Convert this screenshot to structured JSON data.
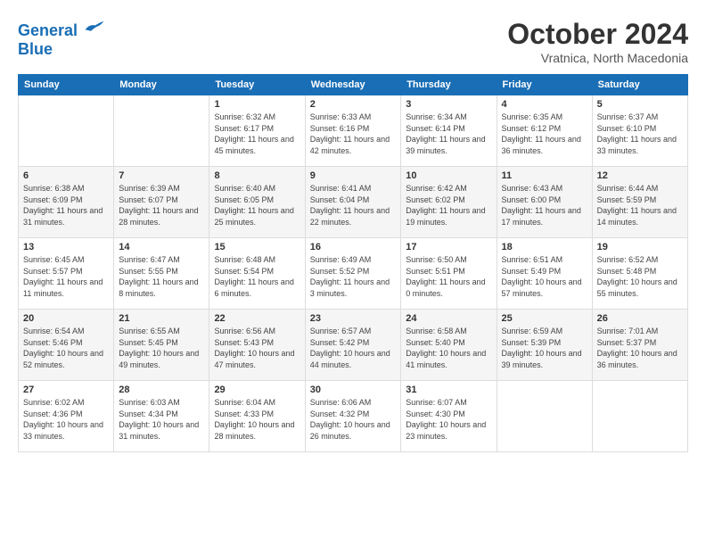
{
  "header": {
    "logo_line1": "General",
    "logo_line2": "Blue",
    "month_title": "October 2024",
    "location": "Vratnica, North Macedonia"
  },
  "weekdays": [
    "Sunday",
    "Monday",
    "Tuesday",
    "Wednesday",
    "Thursday",
    "Friday",
    "Saturday"
  ],
  "weeks": [
    [
      {
        "day": "",
        "sunrise": "",
        "sunset": "",
        "daylight": ""
      },
      {
        "day": "",
        "sunrise": "",
        "sunset": "",
        "daylight": ""
      },
      {
        "day": "1",
        "sunrise": "Sunrise: 6:32 AM",
        "sunset": "Sunset: 6:17 PM",
        "daylight": "Daylight: 11 hours and 45 minutes."
      },
      {
        "day": "2",
        "sunrise": "Sunrise: 6:33 AM",
        "sunset": "Sunset: 6:16 PM",
        "daylight": "Daylight: 11 hours and 42 minutes."
      },
      {
        "day": "3",
        "sunrise": "Sunrise: 6:34 AM",
        "sunset": "Sunset: 6:14 PM",
        "daylight": "Daylight: 11 hours and 39 minutes."
      },
      {
        "day": "4",
        "sunrise": "Sunrise: 6:35 AM",
        "sunset": "Sunset: 6:12 PM",
        "daylight": "Daylight: 11 hours and 36 minutes."
      },
      {
        "day": "5",
        "sunrise": "Sunrise: 6:37 AM",
        "sunset": "Sunset: 6:10 PM",
        "daylight": "Daylight: 11 hours and 33 minutes."
      }
    ],
    [
      {
        "day": "6",
        "sunrise": "Sunrise: 6:38 AM",
        "sunset": "Sunset: 6:09 PM",
        "daylight": "Daylight: 11 hours and 31 minutes."
      },
      {
        "day": "7",
        "sunrise": "Sunrise: 6:39 AM",
        "sunset": "Sunset: 6:07 PM",
        "daylight": "Daylight: 11 hours and 28 minutes."
      },
      {
        "day": "8",
        "sunrise": "Sunrise: 6:40 AM",
        "sunset": "Sunset: 6:05 PM",
        "daylight": "Daylight: 11 hours and 25 minutes."
      },
      {
        "day": "9",
        "sunrise": "Sunrise: 6:41 AM",
        "sunset": "Sunset: 6:04 PM",
        "daylight": "Daylight: 11 hours and 22 minutes."
      },
      {
        "day": "10",
        "sunrise": "Sunrise: 6:42 AM",
        "sunset": "Sunset: 6:02 PM",
        "daylight": "Daylight: 11 hours and 19 minutes."
      },
      {
        "day": "11",
        "sunrise": "Sunrise: 6:43 AM",
        "sunset": "Sunset: 6:00 PM",
        "daylight": "Daylight: 11 hours and 17 minutes."
      },
      {
        "day": "12",
        "sunrise": "Sunrise: 6:44 AM",
        "sunset": "Sunset: 5:59 PM",
        "daylight": "Daylight: 11 hours and 14 minutes."
      }
    ],
    [
      {
        "day": "13",
        "sunrise": "Sunrise: 6:45 AM",
        "sunset": "Sunset: 5:57 PM",
        "daylight": "Daylight: 11 hours and 11 minutes."
      },
      {
        "day": "14",
        "sunrise": "Sunrise: 6:47 AM",
        "sunset": "Sunset: 5:55 PM",
        "daylight": "Daylight: 11 hours and 8 minutes."
      },
      {
        "day": "15",
        "sunrise": "Sunrise: 6:48 AM",
        "sunset": "Sunset: 5:54 PM",
        "daylight": "Daylight: 11 hours and 6 minutes."
      },
      {
        "day": "16",
        "sunrise": "Sunrise: 6:49 AM",
        "sunset": "Sunset: 5:52 PM",
        "daylight": "Daylight: 11 hours and 3 minutes."
      },
      {
        "day": "17",
        "sunrise": "Sunrise: 6:50 AM",
        "sunset": "Sunset: 5:51 PM",
        "daylight": "Daylight: 11 hours and 0 minutes."
      },
      {
        "day": "18",
        "sunrise": "Sunrise: 6:51 AM",
        "sunset": "Sunset: 5:49 PM",
        "daylight": "Daylight: 10 hours and 57 minutes."
      },
      {
        "day": "19",
        "sunrise": "Sunrise: 6:52 AM",
        "sunset": "Sunset: 5:48 PM",
        "daylight": "Daylight: 10 hours and 55 minutes."
      }
    ],
    [
      {
        "day": "20",
        "sunrise": "Sunrise: 6:54 AM",
        "sunset": "Sunset: 5:46 PM",
        "daylight": "Daylight: 10 hours and 52 minutes."
      },
      {
        "day": "21",
        "sunrise": "Sunrise: 6:55 AM",
        "sunset": "Sunset: 5:45 PM",
        "daylight": "Daylight: 10 hours and 49 minutes."
      },
      {
        "day": "22",
        "sunrise": "Sunrise: 6:56 AM",
        "sunset": "Sunset: 5:43 PM",
        "daylight": "Daylight: 10 hours and 47 minutes."
      },
      {
        "day": "23",
        "sunrise": "Sunrise: 6:57 AM",
        "sunset": "Sunset: 5:42 PM",
        "daylight": "Daylight: 10 hours and 44 minutes."
      },
      {
        "day": "24",
        "sunrise": "Sunrise: 6:58 AM",
        "sunset": "Sunset: 5:40 PM",
        "daylight": "Daylight: 10 hours and 41 minutes."
      },
      {
        "day": "25",
        "sunrise": "Sunrise: 6:59 AM",
        "sunset": "Sunset: 5:39 PM",
        "daylight": "Daylight: 10 hours and 39 minutes."
      },
      {
        "day": "26",
        "sunrise": "Sunrise: 7:01 AM",
        "sunset": "Sunset: 5:37 PM",
        "daylight": "Daylight: 10 hours and 36 minutes."
      }
    ],
    [
      {
        "day": "27",
        "sunrise": "Sunrise: 6:02 AM",
        "sunset": "Sunset: 4:36 PM",
        "daylight": "Daylight: 10 hours and 33 minutes."
      },
      {
        "day": "28",
        "sunrise": "Sunrise: 6:03 AM",
        "sunset": "Sunset: 4:34 PM",
        "daylight": "Daylight: 10 hours and 31 minutes."
      },
      {
        "day": "29",
        "sunrise": "Sunrise: 6:04 AM",
        "sunset": "Sunset: 4:33 PM",
        "daylight": "Daylight: 10 hours and 28 minutes."
      },
      {
        "day": "30",
        "sunrise": "Sunrise: 6:06 AM",
        "sunset": "Sunset: 4:32 PM",
        "daylight": "Daylight: 10 hours and 26 minutes."
      },
      {
        "day": "31",
        "sunrise": "Sunrise: 6:07 AM",
        "sunset": "Sunset: 4:30 PM",
        "daylight": "Daylight: 10 hours and 23 minutes."
      },
      {
        "day": "",
        "sunrise": "",
        "sunset": "",
        "daylight": ""
      },
      {
        "day": "",
        "sunrise": "",
        "sunset": "",
        "daylight": ""
      }
    ]
  ]
}
